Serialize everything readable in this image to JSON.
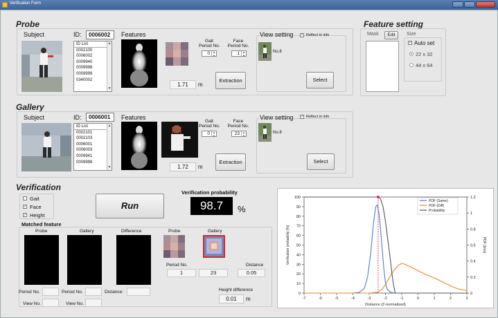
{
  "window": {
    "title": "Verification Form"
  },
  "probe": {
    "title": "Probe",
    "subject_label": "Subject",
    "id_label": "ID:",
    "id_value": "0006002",
    "id_list_header": "ID List",
    "id_list": [
      "0002100",
      "0006002",
      "0009940",
      "0009998",
      "0009999",
      "0340002"
    ],
    "features_label": "Features",
    "gait_period_label": [
      "Gait",
      "Period No."
    ],
    "gait_period_value": "0",
    "face_period_label": [
      "Face",
      "Period No."
    ],
    "face_period_value": "1",
    "height_value": "1.71",
    "height_unit": "m",
    "extraction_button": "Extraction",
    "view_setting_label": "View setting",
    "reflect_label": "Reflect in info",
    "view_no": "No.8",
    "select_button": "Select"
  },
  "gallery": {
    "title": "Gallery",
    "subject_label": "Subject",
    "id_label": "ID:",
    "id_value": "0006001",
    "id_list_header": "ID List",
    "id_list": [
      "0002101",
      "0002103",
      "0006001",
      "0006003",
      "0009941",
      "0009998"
    ],
    "features_label": "Features",
    "gait_period_label": [
      "Gait",
      "Period No."
    ],
    "gait_period_value": "0",
    "face_period_label": [
      "Face",
      "Period No."
    ],
    "face_period_value": "23",
    "height_value": "1.72",
    "height_unit": "m",
    "extraction_button": "Extraction",
    "view_setting_label": "View setting",
    "reflect_label": "Reflect in info",
    "view_no": "No.8",
    "select_button": "Select"
  },
  "feature_setting": {
    "title": "Feature setting",
    "mask_label": "Mask",
    "edit_button": "Edit",
    "size_label": "Size",
    "auto_set_label": "Auto set",
    "auto_set_checked": true,
    "size_options": [
      "22 x 32",
      "44 x 64"
    ],
    "size_selected": "22 x 32"
  },
  "verification": {
    "title": "Verification",
    "modalities": [
      {
        "label": "Gait",
        "checked": false
      },
      {
        "label": "Face",
        "checked": true
      },
      {
        "label": "Height",
        "checked": true
      }
    ],
    "run_button": "Run",
    "probability_label": "Verification probability",
    "probability_value": "98.7",
    "probability_unit": "%",
    "matched_feature_label": "Matched feature",
    "col_probe": "Probe",
    "col_gallery": "Gallery",
    "col_difference": "Difference",
    "face_probe_label": "Probe",
    "face_gallery_label": "Gallery",
    "period_no_label": "Period No.",
    "distance_label": "Distance",
    "face_probe_period": "1",
    "face_gallery_period": "23",
    "face_distance": "0.05",
    "gait_period_label_1": "Period No.",
    "gait_period_label_2": "Period No.",
    "gait_distance_label": "Distance:",
    "view_no_label_1": "View No.",
    "view_no_label_2": "View No.",
    "height_difference_label": "Height difference",
    "height_difference_value": "0.01",
    "height_difference_unit": "m"
  },
  "chart_data": {
    "type": "line",
    "xlabel": "Distance (Z-normalized)",
    "ylabel": "Verification probability [%]",
    "y2label": "PDF [bins]",
    "xlim": [
      -7,
      3
    ],
    "ylim": [
      0,
      100
    ],
    "y2lim": [
      0,
      1.2
    ],
    "x_ticks": [
      -7,
      -6,
      -5,
      -4,
      -3,
      -2,
      -1,
      0,
      1,
      2,
      3
    ],
    "y_ticks": [
      0,
      10,
      20,
      30,
      40,
      50,
      60,
      70,
      80,
      90,
      100
    ],
    "y2_ticks": [
      0,
      0.2,
      0.4,
      0.6,
      0.8,
      1,
      1.2
    ],
    "marker_x": -2.45,
    "marker_y": 100,
    "legend_position": "top-right",
    "series": [
      {
        "name": "PDF (Same)",
        "axis": "right",
        "color": "#4a7fc1",
        "x": [
          -7,
          -4,
          -3.6,
          -3.3,
          -3.1,
          -2.9,
          -2.75,
          -2.6,
          -2.5,
          -2.4,
          -2.3,
          -2.2,
          -2.1,
          -2.0,
          -1.9,
          -1.7,
          -1.4,
          -1,
          0,
          3
        ],
        "y": [
          0,
          0,
          0.01,
          0.06,
          0.2,
          0.5,
          0.85,
          1.08,
          1.1,
          1.0,
          0.8,
          0.55,
          0.3,
          0.13,
          0.05,
          0.01,
          0,
          0,
          0,
          0
        ]
      },
      {
        "name": "PDF (Diff)",
        "axis": "right",
        "color": "#e8862a",
        "x": [
          -7,
          -3,
          -2.5,
          -2.2,
          -2.0,
          -1.8,
          -1.5,
          -1.2,
          -1.0,
          -0.8,
          -0.5,
          -0.2,
          0,
          0.5,
          1,
          1.5,
          2,
          2.5,
          3
        ],
        "y": [
          0,
          0,
          0.01,
          0.05,
          0.11,
          0.18,
          0.28,
          0.35,
          0.37,
          0.36,
          0.33,
          0.3,
          0.28,
          0.23,
          0.19,
          0.14,
          0.09,
          0.05,
          0.03
        ]
      },
      {
        "name": "Probability",
        "axis": "left",
        "color": "#555555",
        "x": [
          -7,
          -3,
          -2.6,
          -2.45,
          -2.3,
          -2.15,
          -2.0,
          -1.85,
          -1.7,
          -1.6,
          -1.5,
          -1.4,
          3
        ],
        "y": [
          100,
          100,
          100,
          100,
          98,
          90,
          75,
          55,
          35,
          20,
          8,
          0,
          0
        ]
      }
    ]
  }
}
